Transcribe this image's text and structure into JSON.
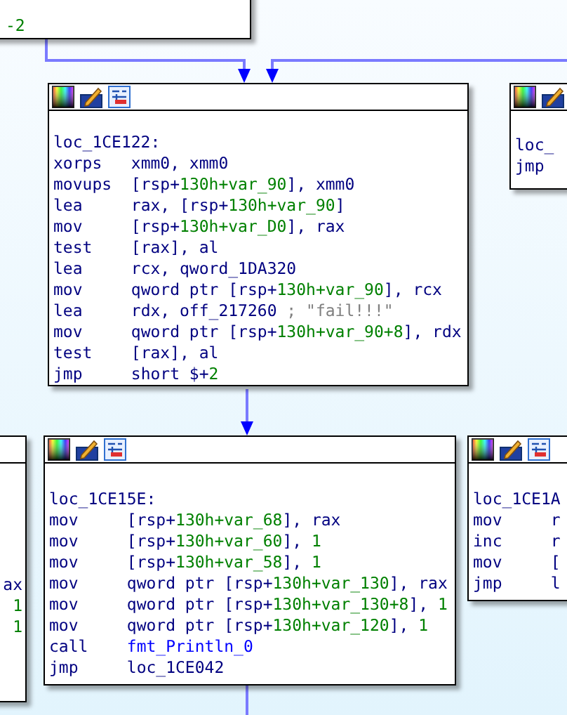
{
  "nodes": [
    {
      "lines": [
        {
          "args": [
            {
              "text": "-2",
              "kind": "number"
            }
          ]
        }
      ]
    },
    {
      "label": "loc_1CE122:",
      "lines": [
        {
          "op": "xorps",
          "args": [
            {
              "text": "xmm0, xmm0",
              "kind": "operand"
            }
          ]
        },
        {
          "op": "movups",
          "args": [
            {
              "text": "[rsp+",
              "kind": "operand"
            },
            {
              "text": "130h+var_90",
              "kind": "number"
            },
            {
              "text": "], xmm0",
              "kind": "operand"
            }
          ]
        },
        {
          "op": "lea",
          "args": [
            {
              "text": "rax, [rsp+",
              "kind": "operand"
            },
            {
              "text": "130h+var_90",
              "kind": "number"
            },
            {
              "text": "]",
              "kind": "operand"
            }
          ]
        },
        {
          "op": "mov",
          "args": [
            {
              "text": "[rsp+",
              "kind": "operand"
            },
            {
              "text": "130h+var_D0",
              "kind": "number"
            },
            {
              "text": "], rax",
              "kind": "operand"
            }
          ]
        },
        {
          "op": "test",
          "args": [
            {
              "text": "[rax], al",
              "kind": "operand"
            }
          ]
        },
        {
          "op": "lea",
          "args": [
            {
              "text": "rcx, qword_1DA320",
              "kind": "operand"
            }
          ]
        },
        {
          "op": "mov",
          "args": [
            {
              "text": "qword ptr [rsp+",
              "kind": "operand"
            },
            {
              "text": "130h+var_90",
              "kind": "number"
            },
            {
              "text": "], rcx",
              "kind": "operand"
            }
          ]
        },
        {
          "op": "lea",
          "args": [
            {
              "text": "rdx, off_217260 ",
              "kind": "operand"
            },
            {
              "text": "; \"fail!!!\"",
              "kind": "comment"
            }
          ]
        },
        {
          "op": "mov",
          "args": [
            {
              "text": "qword ptr [rsp+",
              "kind": "operand"
            },
            {
              "text": "130h+var_90+8",
              "kind": "number"
            },
            {
              "text": "], rdx",
              "kind": "operand"
            }
          ]
        },
        {
          "op": "test",
          "args": [
            {
              "text": "[rax], al",
              "kind": "operand"
            }
          ]
        },
        {
          "op": "jmp",
          "args": [
            {
              "text": "short $+",
              "kind": "operand"
            },
            {
              "text": "2",
              "kind": "number"
            }
          ]
        }
      ]
    },
    {
      "label": "loc_",
      "lines": [
        {
          "op": "jmp"
        }
      ]
    },
    {
      "lines": [
        {
          "args": [
            {
              "text": "ax",
              "kind": "operand"
            }
          ]
        },
        {
          "args": [
            {
              "text": "1",
              "kind": "number"
            }
          ]
        },
        {
          "args": [
            {
              "text": "1",
              "kind": "number"
            }
          ]
        }
      ]
    },
    {
      "label": "loc_1CE15E:",
      "lines": [
        {
          "op": "mov",
          "args": [
            {
              "text": "[rsp+",
              "kind": "operand"
            },
            {
              "text": "130h+var_68",
              "kind": "number"
            },
            {
              "text": "], rax",
              "kind": "operand"
            }
          ]
        },
        {
          "op": "mov",
          "args": [
            {
              "text": "[rsp+",
              "kind": "operand"
            },
            {
              "text": "130h+var_60",
              "kind": "number"
            },
            {
              "text": "], ",
              "kind": "operand"
            },
            {
              "text": "1",
              "kind": "number"
            }
          ]
        },
        {
          "op": "mov",
          "args": [
            {
              "text": "[rsp+",
              "kind": "operand"
            },
            {
              "text": "130h+var_58",
              "kind": "number"
            },
            {
              "text": "], ",
              "kind": "operand"
            },
            {
              "text": "1",
              "kind": "number"
            }
          ]
        },
        {
          "op": "mov",
          "args": [
            {
              "text": "qword ptr [rsp+",
              "kind": "operand"
            },
            {
              "text": "130h+var_130",
              "kind": "number"
            },
            {
              "text": "], rax",
              "kind": "operand"
            }
          ]
        },
        {
          "op": "mov",
          "args": [
            {
              "text": "qword ptr [rsp+",
              "kind": "operand"
            },
            {
              "text": "130h+var_130+8",
              "kind": "number"
            },
            {
              "text": "], ",
              "kind": "operand"
            },
            {
              "text": "1",
              "kind": "number"
            }
          ]
        },
        {
          "op": "mov",
          "args": [
            {
              "text": "qword ptr [rsp+",
              "kind": "operand"
            },
            {
              "text": "130h+var_120",
              "kind": "number"
            },
            {
              "text": "], ",
              "kind": "operand"
            },
            {
              "text": "1",
              "kind": "number"
            }
          ]
        },
        {
          "op": "call",
          "args": [
            {
              "text": "fmt_Println_0",
              "kind": "function"
            }
          ]
        },
        {
          "op": "jmp",
          "args": [
            {
              "text": "loc_1CE042",
              "kind": "operand"
            }
          ]
        }
      ]
    },
    {
      "label": "loc_1CE1A",
      "lines": [
        {
          "op": "mov",
          "args": [
            {
              "text": "r",
              "kind": "operand"
            }
          ]
        },
        {
          "op": "inc",
          "args": [
            {
              "text": "r",
              "kind": "operand"
            }
          ]
        },
        {
          "op": "mov",
          "args": [
            {
              "text": "[",
              "kind": "operand"
            }
          ]
        },
        {
          "op": "jmp",
          "args": [
            {
              "text": "l",
              "kind": "operand"
            }
          ]
        }
      ]
    }
  ]
}
